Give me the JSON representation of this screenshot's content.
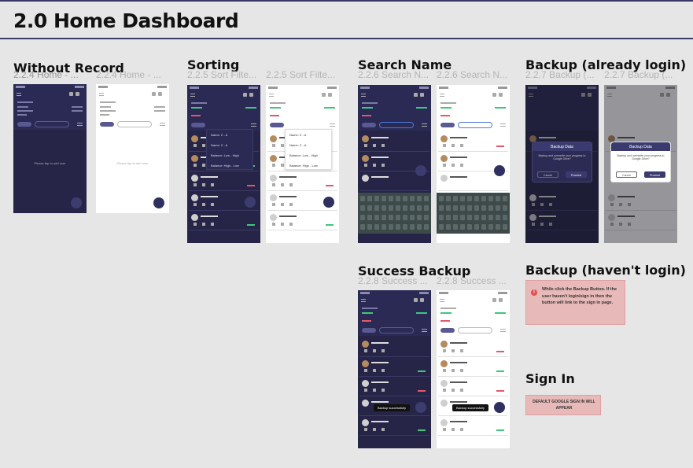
{
  "page_title": "2.0 Home Dashboard",
  "sections": {
    "without_record": {
      "title": "Without Record",
      "sub1": "2.2.4 Home - ...",
      "sub2": "2.2.4 Home - ...",
      "empty1": "Please tap  to add user",
      "empty2": "Please tap  to add user"
    },
    "sorting": {
      "title": "Sorting",
      "sub1": "2.2.5 Sort Filte...",
      "sub2": "2.2.5 Sort Filte...",
      "options": [
        "Name: Z - A",
        "Name: Z - A",
        "Balance: Low - High",
        "Balance: High - Low"
      ]
    },
    "search_name": {
      "title": "Search Name",
      "sub1": "2.2.6 Search N...",
      "sub2": "2.2.6 Search N..."
    },
    "backup_login": {
      "title": "Backup (already login)",
      "sub1": "2.2.7 Backup (...",
      "sub2": "2.2.7 Backup (...",
      "modal_title": "Backup Data",
      "modal_body": "Backup and overwrite your progress to Google Drive?",
      "cancel": "Cancel",
      "proceed": "Proceed"
    },
    "success_backup": {
      "title": "Success Backup",
      "sub1": "2.2.8 Success ...",
      "sub2": "2.2.8 Success ...",
      "toast": "Backup successfully"
    },
    "backup_no_login": {
      "title": "Backup (haven't login)",
      "note": "While click the Backup Button. If the user haven't login/sign in then the button will link to the sign in page."
    },
    "sign_in": {
      "title": "Sign In",
      "note": "DEFAULT GOOGLE SIGN IN WILL APPEAR"
    }
  },
  "colors": {
    "dark_bg": "#262547",
    "accent_green": "#3ec77c",
    "accent_red": "#e4576a",
    "note_bg": "#e8b9b9"
  }
}
